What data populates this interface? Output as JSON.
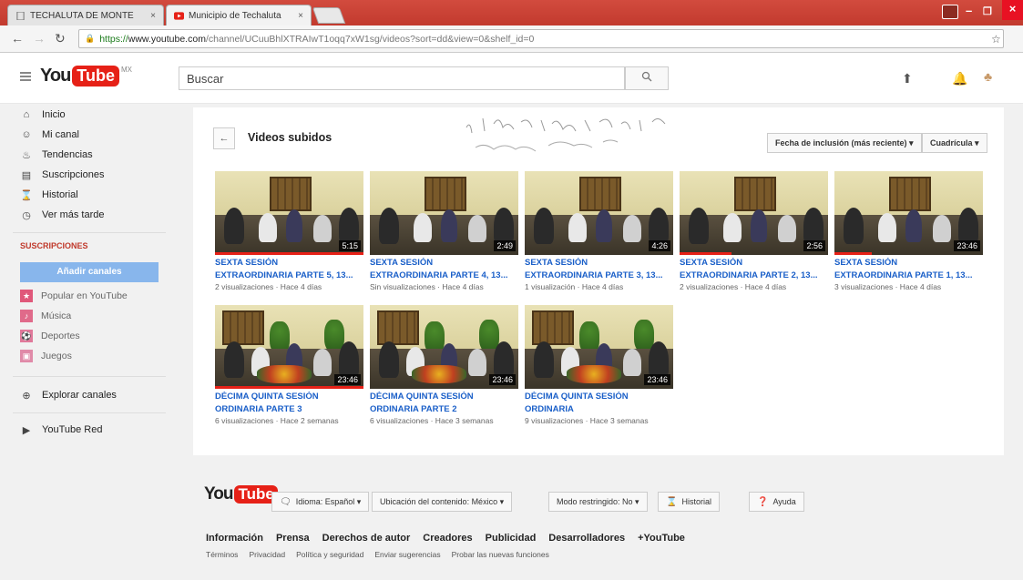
{
  "browser": {
    "tabs": [
      {
        "title": "TECHALUTA DE MONTE",
        "close": "×"
      },
      {
        "title": "Municipio de Techaluta",
        "close": "×"
      }
    ],
    "url_prefix": "https://",
    "url_host": "www.youtube.com",
    "url_path": "/channel/UCuuBhlXTRAIwT1oqq7xW1sg/videos?sort=dd&view=0&shelf_id=0",
    "window_buttons": {
      "minimize": "–",
      "maximize": "❐",
      "close": "×"
    }
  },
  "header": {
    "logo_you": "You",
    "logo_tube": "Tube",
    "logo_region": "MX",
    "search_placeholder": "Buscar",
    "icons": [
      "menu-icon",
      "search-icon",
      "upload-icon",
      "bell-icon",
      "avatar"
    ]
  },
  "sidebar": {
    "items": [
      {
        "label": "Inicio",
        "icon": "home-icon",
        "glyph": "⌂"
      },
      {
        "label": "Mi canal",
        "icon": "user-icon",
        "glyph": "☺"
      },
      {
        "label": "Tendencias",
        "icon": "flame-icon",
        "glyph": "♨"
      },
      {
        "label": "Suscripciones",
        "icon": "subscriptions-icon",
        "glyph": "▤"
      },
      {
        "label": "Historial",
        "icon": "hourglass-icon",
        "glyph": "⌛"
      },
      {
        "label": "Ver más tarde",
        "icon": "clock-icon",
        "glyph": "◷"
      }
    ],
    "subscriptions_heading": "SUSCRIPCIONES",
    "add_channels": "Añadir canales",
    "subscriptions": [
      {
        "label": "Popular en YouTube",
        "color": "#e0587a",
        "glyph": "★"
      },
      {
        "label": "Música",
        "color": "#e06a8a",
        "glyph": "♪"
      },
      {
        "label": "Deportes",
        "color": "#e0789a",
        "glyph": "⚽"
      },
      {
        "label": "Juegos",
        "color": "#e08aa8",
        "glyph": "▣"
      }
    ],
    "explore": {
      "label": "Explorar canales",
      "glyph": "⊕"
    },
    "red": {
      "label": "YouTube Red",
      "glyph": "▶"
    }
  },
  "main": {
    "section_title": "Videos subidos",
    "sort_label": "Fecha de inclusión (más reciente) ▾",
    "view_label": "Cuadrícula ▾",
    "videos": [
      {
        "title_1": "SEXTA SESIÓN",
        "title_2": "EXTRAORDINARIA PARTE 5, 13...",
        "meta": "2 visualizaciones · Hace 4 días",
        "duration": "5:15",
        "progress": 1.0
      },
      {
        "title_1": "SEXTA SESIÓN",
        "title_2": "EXTRAORDINARIA PARTE 4, 13...",
        "meta": "Sin visualizaciones · Hace 4 días",
        "duration": "2:49",
        "progress": 0.0
      },
      {
        "title_1": "SEXTA SESIÓN",
        "title_2": "EXTRAORDINARIA PARTE 3, 13...",
        "meta": "1 visualización · Hace 4 días",
        "duration": "4:26",
        "progress": 0.0
      },
      {
        "title_1": "SEXTA SESIÓN",
        "title_2": "EXTRAORDINARIA PARTE 2, 13...",
        "meta": "2 visualizaciones · Hace 4 días",
        "duration": "2:56",
        "progress": 0.35
      },
      {
        "title_1": "SEXTA SESIÓN",
        "title_2": "EXTRAORDINARIA PARTE 1, 13...",
        "meta": "3 visualizaciones · Hace 4 días",
        "duration": "23:46",
        "progress": 0.25
      },
      {
        "title_1": "DÉCIMA QUINTA SESIÓN",
        "title_2": "ORDINARIA PARTE 3",
        "meta": "6 visualizaciones · Hace 2 semanas",
        "duration": "23:46",
        "progress": 1.0
      },
      {
        "title_1": "DÉCIMA QUINTA SESIÓN",
        "title_2": "ORDINARIA PARTE 2",
        "meta": "6 visualizaciones · Hace 3 semanas",
        "duration": "23:46",
        "progress": 0.0
      },
      {
        "title_1": "DÉCIMA QUINTA SESIÓN",
        "title_2": "ORDINARIA",
        "meta": "9 visualizaciones · Hace 3 semanas",
        "duration": "23:46",
        "progress": 0.0
      }
    ]
  },
  "footer": {
    "logo_you": "You",
    "logo_tube": "Tube",
    "language": "Idioma: Español ▾",
    "location": "Ubicación del contenido: México ▾",
    "restricted": "Modo restringido: No ▾",
    "history": "Historial",
    "help": "Ayuda",
    "links": [
      "Información",
      "Prensa",
      "Derechos de autor",
      "Creadores",
      "Publicidad",
      "Desarrolladores",
      "+YouTube"
    ],
    "links2": [
      "Términos",
      "Privacidad",
      "Política y seguridad",
      "Enviar sugerencias",
      "Probar las nuevas funciones"
    ]
  }
}
